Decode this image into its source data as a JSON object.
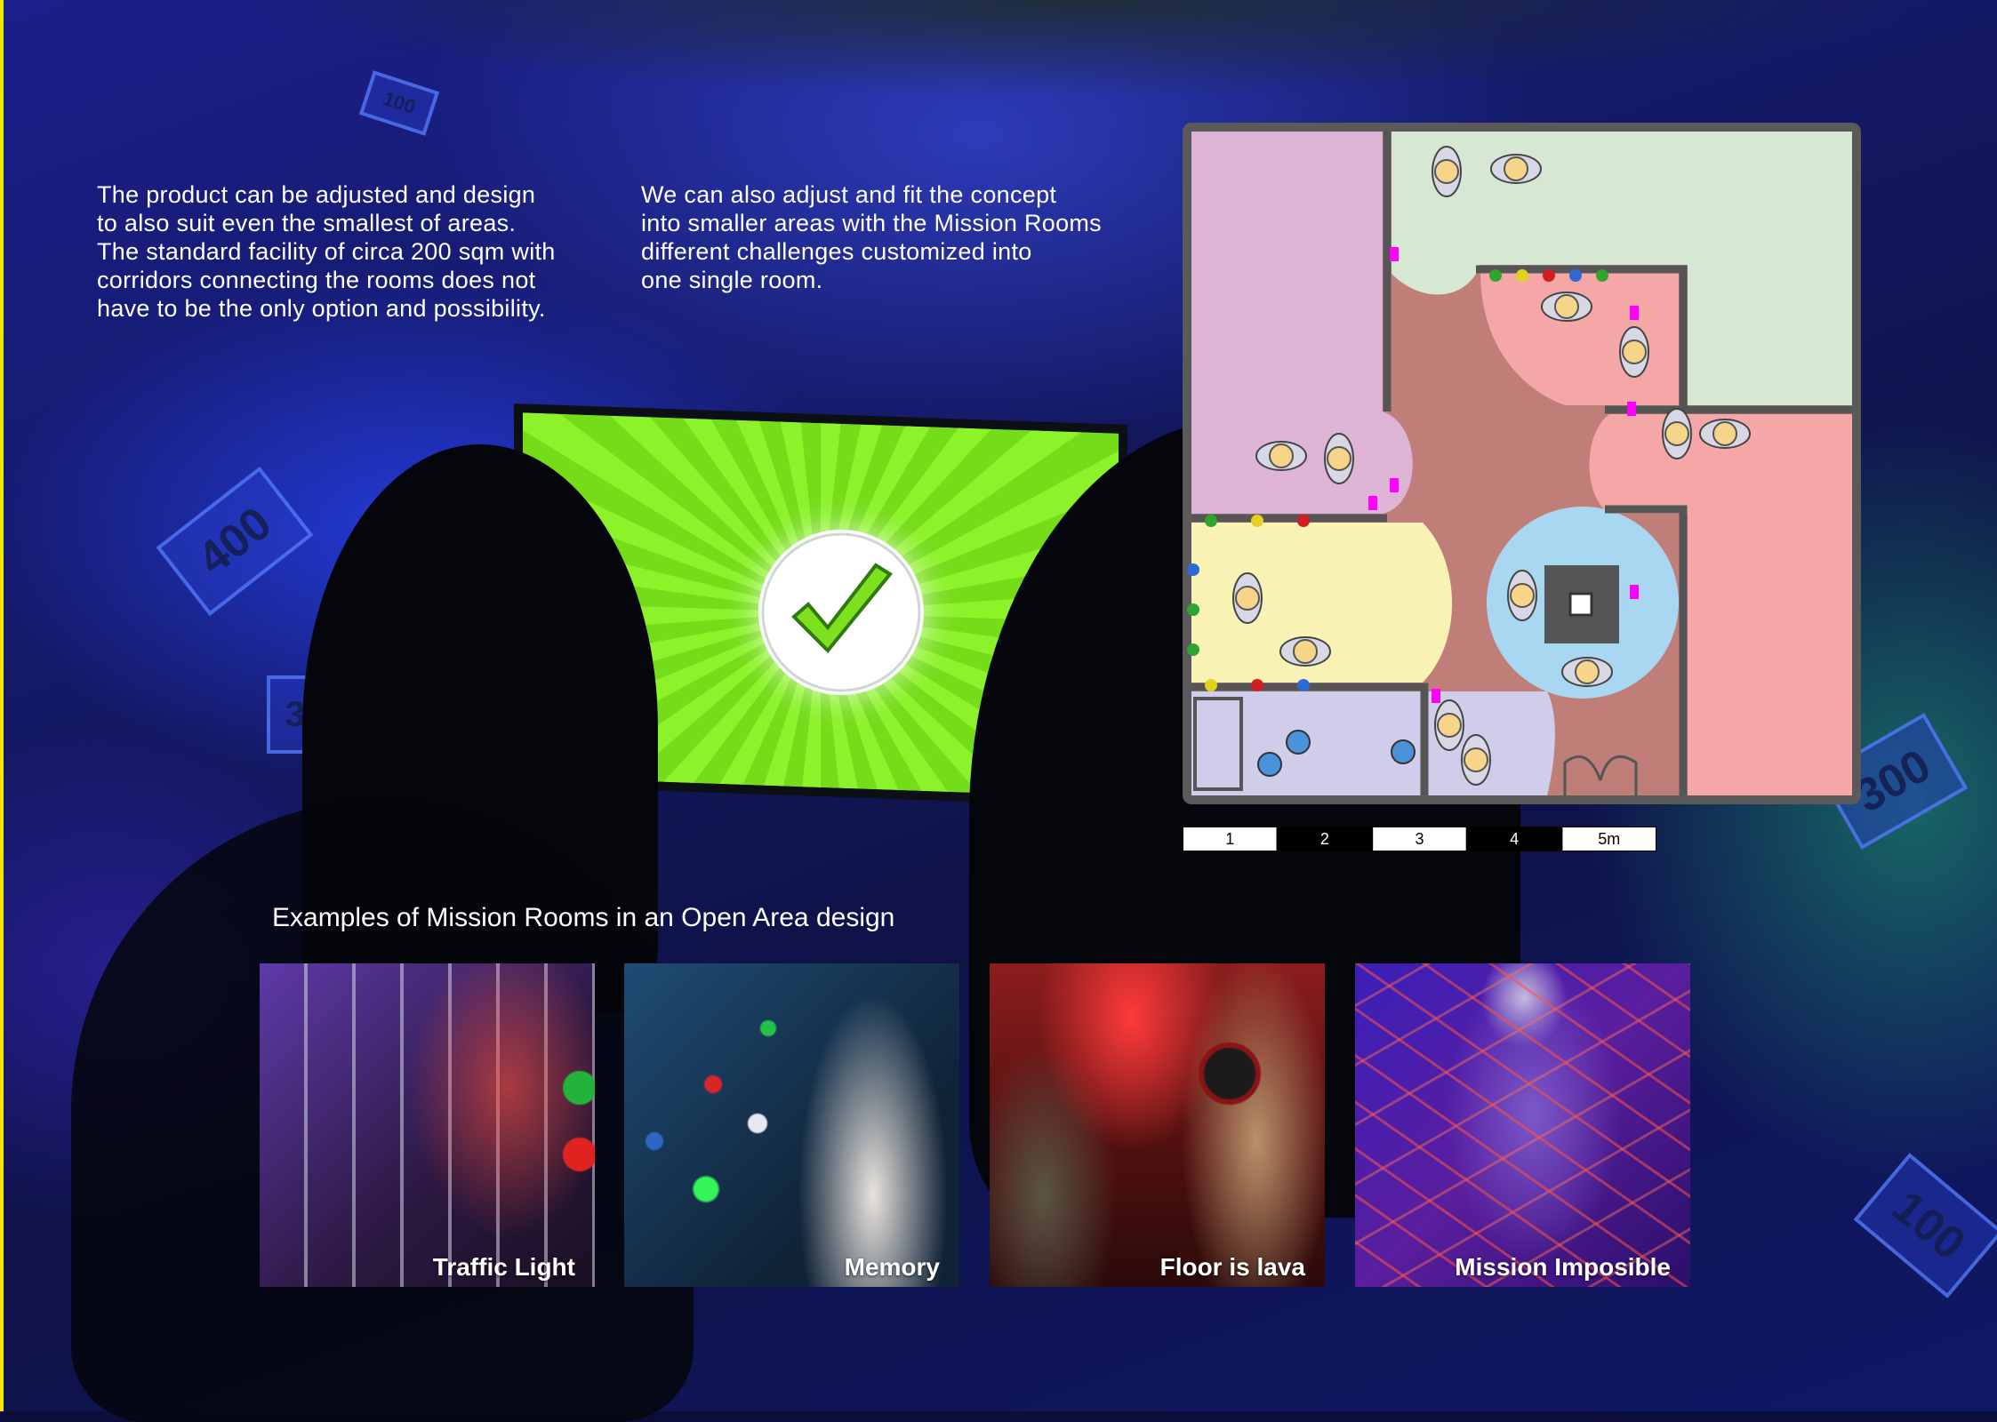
{
  "paragraphs": {
    "left": [
      "The product can be adjusted and design",
      "to also suit even the smallest of areas.",
      "The standard facility of circa 200 sqm with",
      "corridors connecting the rooms does not",
      "have to be the only option and possibility."
    ],
    "right": [
      "We can also adjust and fit the concept",
      "into smaller areas with the Mission Rooms",
      "different challenges customized into",
      "one single room."
    ]
  },
  "floor_plan": {
    "scale_labels": [
      "1",
      "2",
      "3",
      "4",
      "5m"
    ],
    "colors": {
      "purple_room": "#ddb3d6",
      "green_room": "#d6e8d4",
      "pink_room": "#f4a7a6",
      "yellow_room": "#f8f3b5",
      "blue_room": "#a9d6f1",
      "lavender_room": "#cfcde9",
      "center_floor": "#c07e79",
      "wall": "#555555",
      "door_marker": "#ff00ff"
    }
  },
  "background_bills": [
    "400",
    "300",
    "100",
    "100",
    "300"
  ],
  "examples": {
    "title": "Examples of Mission Rooms in an Open Area design",
    "cards": [
      {
        "label": "Traffic Light",
        "accent": "#e8206a"
      },
      {
        "label": "Memory",
        "accent": "#2a6fa8"
      },
      {
        "label": "Floor is lava",
        "accent": "#d72a2a"
      },
      {
        "label": "Mission Imposible",
        "accent": "#7a2fd0"
      }
    ]
  }
}
